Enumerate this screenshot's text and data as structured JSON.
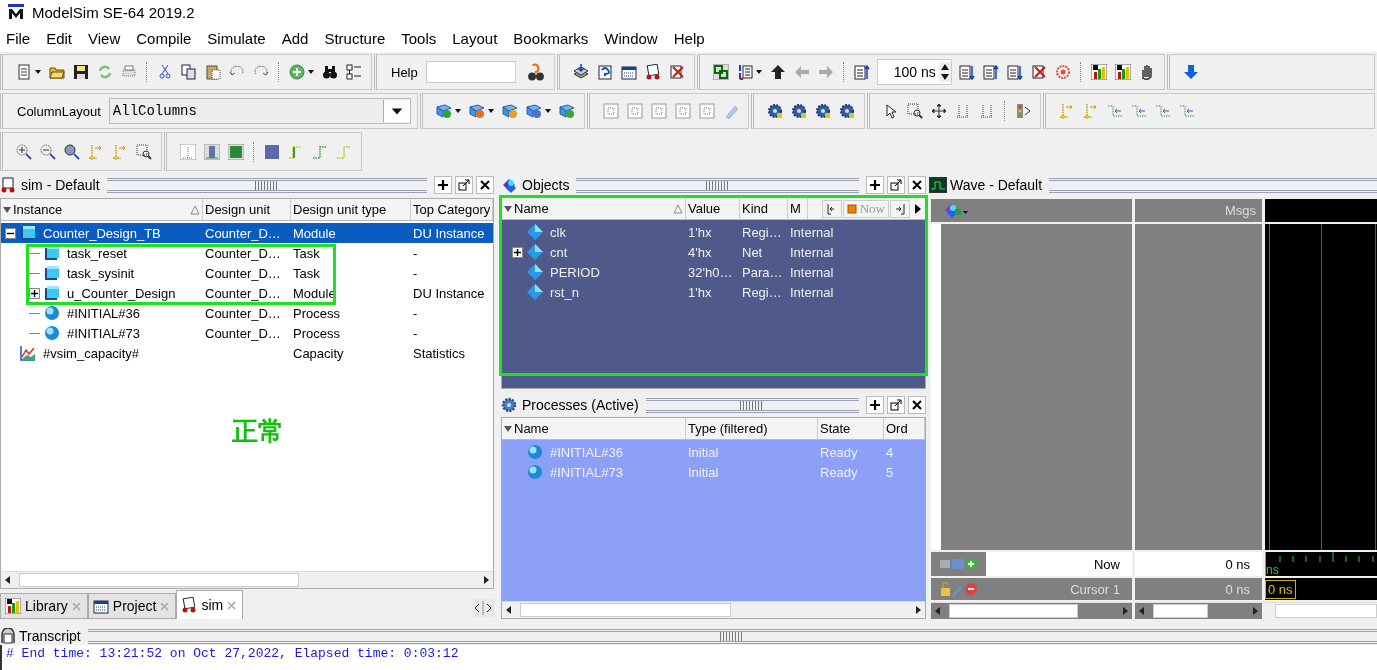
{
  "window": {
    "title": "ModelSim SE-64 2019.2"
  },
  "menu": [
    "File",
    "Edit",
    "View",
    "Compile",
    "Simulate",
    "Add",
    "Structure",
    "Tools",
    "Layout",
    "Bookmarks",
    "Window",
    "Help"
  ],
  "toolbar": {
    "help_label": "Help",
    "run_length": "100 ns",
    "column_layout_label": "ColumnLayout",
    "column_layout_value": "AllColumns"
  },
  "sim_panel": {
    "title": "sim - Default",
    "columns": [
      "Instance",
      "Design unit",
      "Design unit type",
      "Top Category"
    ],
    "instances": [
      {
        "name": "Counter_Design_TB",
        "unit": "Counter_D…",
        "type": "Module",
        "category": "DU Instance",
        "kind": "module",
        "selected": true,
        "expanded": true,
        "children": [
          {
            "name": "task_reset",
            "unit": "Counter_D…",
            "type": "Task",
            "category": "-",
            "kind": "task",
            "selected": false
          },
          {
            "name": "task_sysinit",
            "unit": "Counter_D…",
            "type": "Task",
            "category": "-",
            "kind": "task",
            "selected": false
          },
          {
            "name": "u_Counter_Design",
            "unit": "Counter_D…",
            "type": "Module",
            "category": "DU Instance",
            "kind": "module",
            "selected": false,
            "expanded": false
          },
          {
            "name": "#INITIAL#36",
            "unit": "Counter_D…",
            "type": "Process",
            "category": "-",
            "kind": "process",
            "selected": false
          },
          {
            "name": "#INITIAL#73",
            "unit": "Counter_D…",
            "type": "Process",
            "category": "-",
            "kind": "process",
            "selected": false
          }
        ]
      },
      {
        "name": "#vsim_capacity#",
        "type": "Capacity",
        "category": "Statistics",
        "kind": "capacity",
        "selected": false
      }
    ],
    "tabs": [
      {
        "label": "Library",
        "selected": false
      },
      {
        "label": "Project",
        "selected": false
      },
      {
        "label": "sim",
        "selected": true
      }
    ]
  },
  "objects_panel": {
    "title": "Objects",
    "columns": [
      "Name",
      "Value",
      "Kind",
      "M"
    ],
    "now_label": "Now",
    "rows": [
      {
        "name": "clk",
        "value": "1'hx",
        "kind": "Regi…",
        "mode": "Internal"
      },
      {
        "name": "cnt",
        "value": "4'hx",
        "kind": "Net",
        "mode": "Internal",
        "expanded": false
      },
      {
        "name": "PERIOD",
        "value": "32'h0…",
        "kind": "Para…",
        "mode": "Internal"
      },
      {
        "name": "rst_n",
        "value": "1'hx",
        "kind": "Regi…",
        "mode": "Internal"
      }
    ]
  },
  "processes_panel": {
    "title": "Processes (Active)",
    "columns": [
      "Name",
      "Type (filtered)",
      "State",
      "Ord"
    ],
    "rows": [
      {
        "name": "#INITIAL#36",
        "type": "Initial",
        "state": "Ready",
        "order": "4"
      },
      {
        "name": "#INITIAL#73",
        "type": "Initial",
        "state": "Ready",
        "order": "5"
      }
    ]
  },
  "wave_panel": {
    "title": "Wave - Default",
    "msgs_label": "Msgs",
    "ruler_label": "ns",
    "now": {
      "label": "Now",
      "value": "0 ns"
    },
    "cursor": {
      "label": "Cursor 1",
      "value": "0 ns",
      "time": "0 ns"
    }
  },
  "transcript": {
    "title": "Transcript",
    "lines": [
      "# End time: 13:21:52 on Oct 27,2022, Elapsed time: 0:03:12"
    ]
  },
  "annotation": {
    "text": "正常"
  }
}
